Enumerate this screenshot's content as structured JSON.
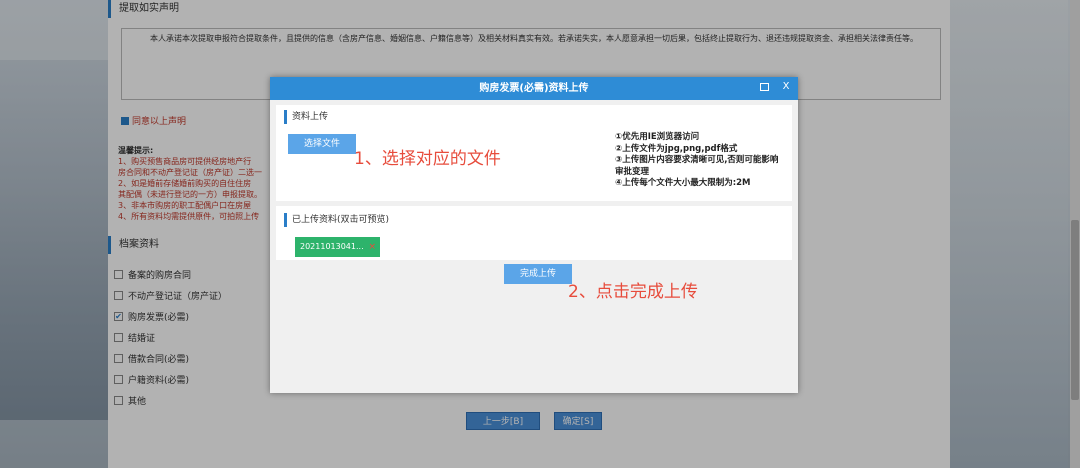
{
  "page": {
    "section_declaration": "提取如实声明",
    "declaration_text": "本人承诺本次提取申报符合提取条件，且提供的信息（含房产信息、婚姻信息、户籍信息等）及相关材料真实有效。若承诺失实，本人愿意承担一切后果，包括终止提取行为、退还违规提取资金、承担相关法律责任等。",
    "agree_label": "同意以上声明",
    "tips_title": "温馨提示:",
    "tips": [
      "1、购买预售商品房可提供经房地产行",
      "房合同和不动产登记证（房产证）二选一",
      "2、如是婚前存储婚前购买的自住住房",
      "其配偶（未进行登记的一方）申报提取。",
      "3、非本市购房的职工配偶户口在房屋",
      "4、所有资料均需提供原件，可拍照上传"
    ],
    "section_archive": "档案资料",
    "archive_items": [
      {
        "label": "备案的购房合同",
        "checked": false
      },
      {
        "label": "不动产登记证（房产证）",
        "checked": false
      },
      {
        "label": "购房发票(必需)",
        "checked": true
      },
      {
        "label": "结婚证",
        "checked": false
      },
      {
        "label": "借款合同(必需)",
        "checked": false
      },
      {
        "label": "户籍资料(必需)",
        "checked": false
      },
      {
        "label": "其他",
        "checked": false
      }
    ],
    "prev_button": "上一步[B]",
    "confirm_button": "确定[S]"
  },
  "modal": {
    "title": "购房发票(必需)资料上传",
    "max_icon": "maximize-icon",
    "close_label": "X",
    "upload_section": "资料上传",
    "choose_button": "选择文件",
    "annotation_1": "1、选择对应的文件",
    "rules": [
      "①优先用IE浏览器访问",
      "②上传文件为jpg,png,pdf格式",
      "③上传图片内容要求清晰可见,否则可能影响审批变理",
      "④上传每个文件大小最大限制为:2M"
    ],
    "uploaded_section": "已上传资料(双击可预览)",
    "file_name": "20211013041...",
    "file_remove": "×",
    "done_button": "完成上传",
    "annotation_2": "2、点击完成上传"
  },
  "colors": {
    "accent": "#2e8cd6",
    "button": "#5ba5e8",
    "file_chip": "#2db36b",
    "annotation": "#e74c3c"
  }
}
